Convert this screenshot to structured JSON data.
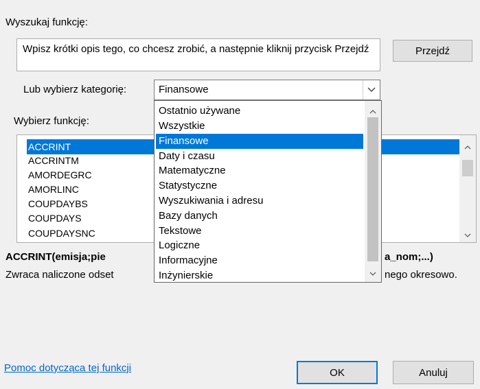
{
  "search": {
    "label": "Wyszukaj funkcję:",
    "text": "Wpisz krótki opis tego, co chcesz zrobić, a następnie kliknij przycisk Przejdź",
    "go_button": "Przejdź"
  },
  "category": {
    "label": "Lub wybierz kategorię:",
    "selected": "Finansowe",
    "options": [
      "Ostatnio używane",
      "Wszystkie",
      "Finansowe",
      "Daty i czasu",
      "Matematyczne",
      "Statystyczne",
      "Wyszukiwania i adresu",
      "Bazy danych",
      "Tekstowe",
      "Logiczne",
      "Informacyjne",
      "Inżynierskie"
    ],
    "highlighted_index": 2
  },
  "functions": {
    "label": "Wybierz funkcję:",
    "items": [
      "ACCRINT",
      "ACCRINTM",
      "AMORDEGRC",
      "AMORLINC",
      "COUPDAYBS",
      "COUPDAYS",
      "COUPDAYSNC"
    ],
    "selected_index": 0
  },
  "description": {
    "signature_left": "ACCRINT(emisja;pie",
    "signature_right": "a_nom;...)",
    "text_left": "Zwraca naliczone odset",
    "text_right": "nego okresowo."
  },
  "footer": {
    "help_link": "Pomoc dotycząca tej funkcji",
    "ok_button": "OK",
    "cancel_button": "Anuluj"
  },
  "colors": {
    "accent": "#0078d7",
    "link": "#0066cc"
  }
}
